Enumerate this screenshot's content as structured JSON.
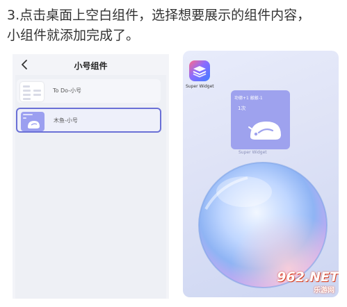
{
  "instruction": {
    "line1": "3.点击桌面上空白组件，选择想要展示的组件内容，",
    "line2": "小组件就添加完成了。"
  },
  "left_screen": {
    "back_icon": "chevron-left-icon",
    "title": "小号组件",
    "items": [
      {
        "label": "To Do-小号",
        "selected": false
      },
      {
        "label": "木鱼-小号",
        "selected": true
      }
    ],
    "selected_border_color": "#6a70d6"
  },
  "right_screen": {
    "app_name": "Super Widget",
    "widget": {
      "top_text": "功德+1 敲敲-1",
      "count_text": "1次",
      "caption": "Super Widget",
      "background": "#9ea2ee"
    }
  },
  "watermark": {
    "brand_number": "962.NET",
    "brand_sub": "乐游网"
  }
}
